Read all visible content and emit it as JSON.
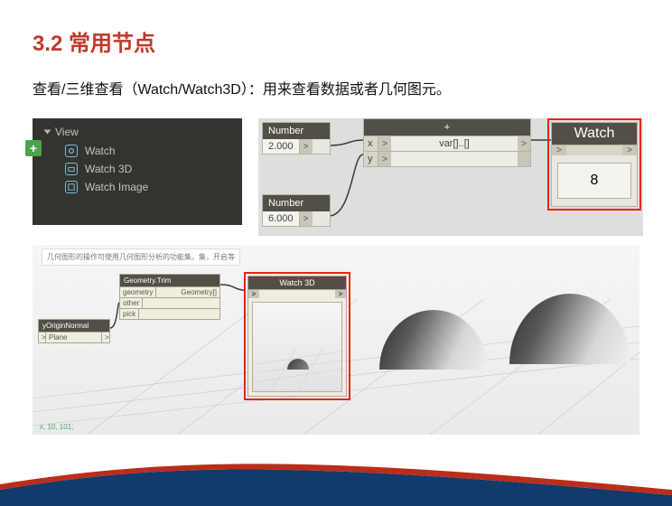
{
  "heading": "3.2 常用节点",
  "description": "查看/三维查看（Watch/Watch3D）：用来查看数据或者几何图元。",
  "library": {
    "category": "View",
    "items": [
      "Watch",
      "Watch 3D",
      "Watch Image"
    ]
  },
  "graph1": {
    "number_label": "Number",
    "number1_value": "2.000",
    "number2_value": "6.000",
    "plus_title": "+",
    "plus_inputs": [
      "x",
      "y"
    ],
    "plus_var": "var[]..[]",
    "watch_title": "Watch",
    "watch_value": "8",
    "port_out": ">",
    "port_in": ">"
  },
  "graph2": {
    "note": "几何图形的操作可使用几何图形分析的功能集。集，开启等",
    "geometry_node": {
      "title": "Geometry.Trim",
      "rows": [
        "geometry",
        "other",
        "pick"
      ],
      "out": "Geometry[]"
    },
    "origin_node": {
      "title": "yOriginNormal",
      "rows": [
        "Plane"
      ]
    },
    "watch3d_title": "Watch 3D",
    "coords": "x, 10, 101;"
  }
}
